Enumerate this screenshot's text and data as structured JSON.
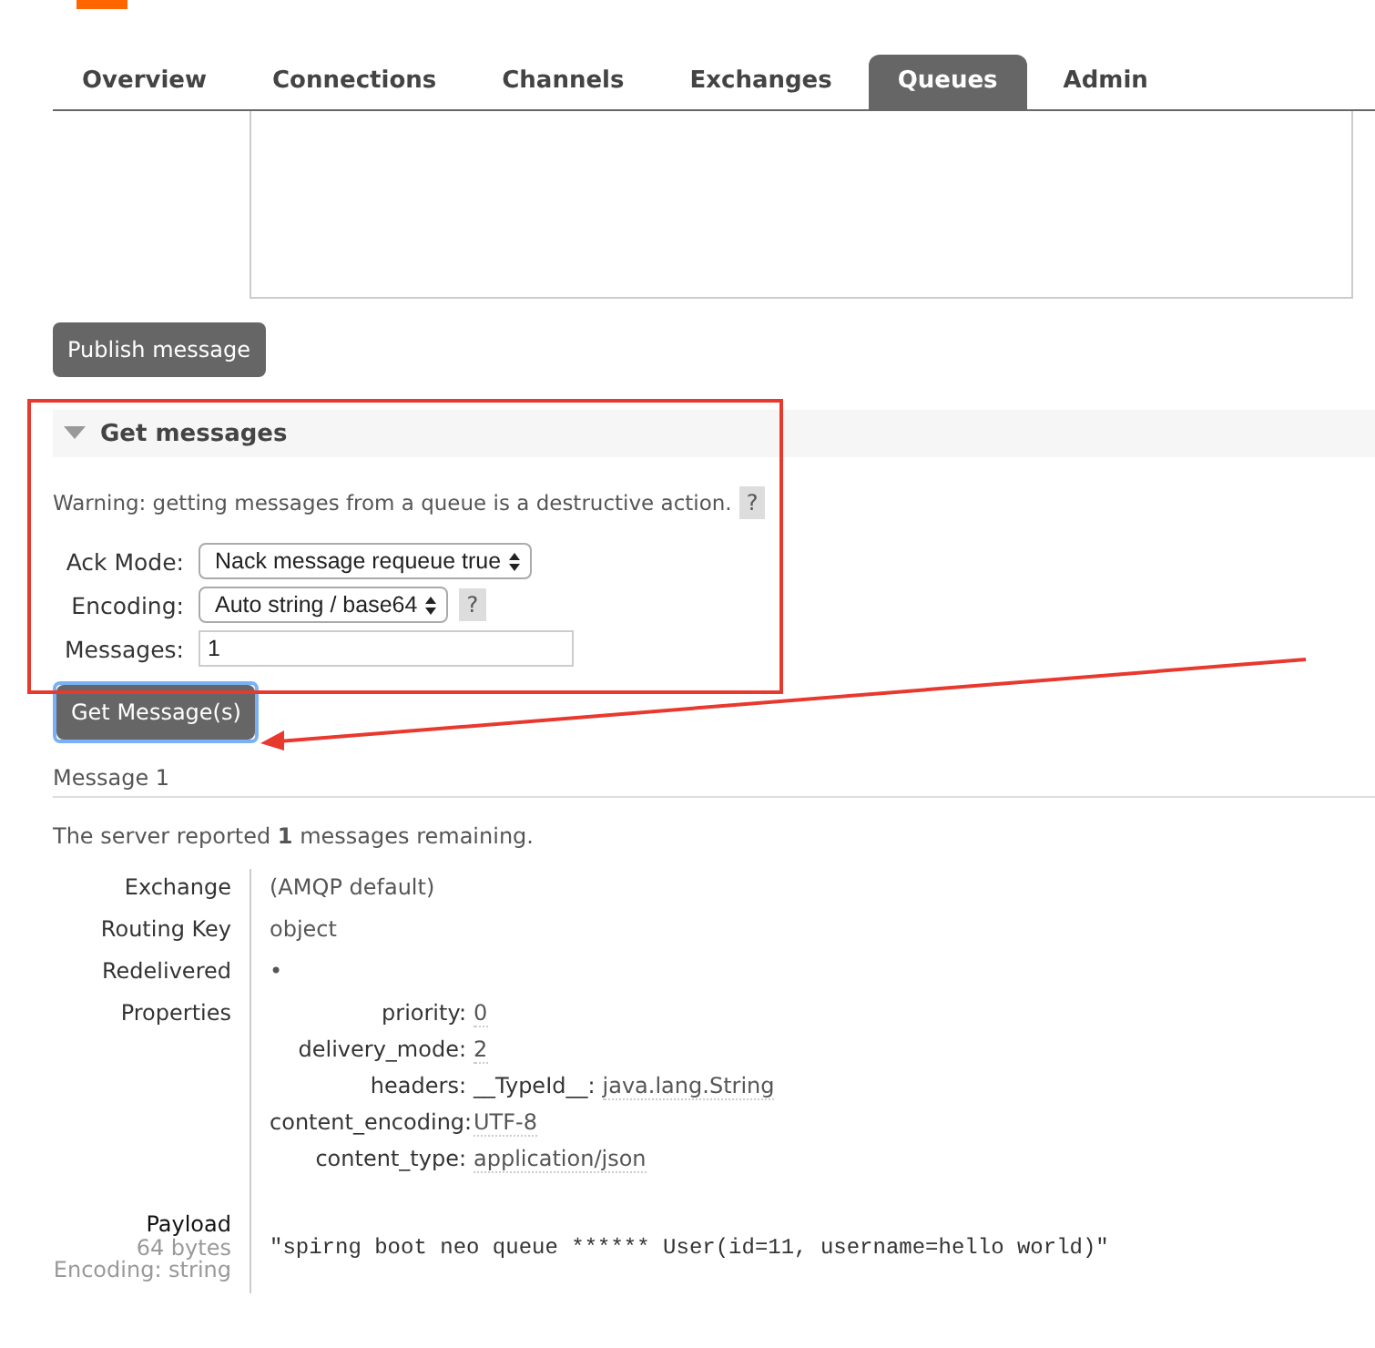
{
  "tabs": [
    {
      "label": "Overview",
      "selected": false
    },
    {
      "label": "Connections",
      "selected": false
    },
    {
      "label": "Channels",
      "selected": false
    },
    {
      "label": "Exchanges",
      "selected": false
    },
    {
      "label": "Queues",
      "selected": true
    },
    {
      "label": "Admin",
      "selected": false
    }
  ],
  "publish_button": "Publish message",
  "get_messages": {
    "title": "Get messages",
    "expanded": true,
    "warning": "Warning: getting messages from a queue is a destructive action.",
    "warning_help": "?",
    "fields": [
      {
        "kind": "select",
        "label": "Ack Mode:",
        "value": "Nack message requeue true"
      },
      {
        "kind": "select",
        "label": "Encoding:",
        "value": "Auto string / base64",
        "help": "?"
      },
      {
        "kind": "input",
        "label": "Messages:",
        "value": "1"
      }
    ],
    "button": "Get Message(s)"
  },
  "message": {
    "title": "Message 1",
    "summary": "The server reported **1** messages remaining.",
    "rows": [
      {
        "label": "Exchange",
        "value": "(AMQP default)"
      },
      {
        "label": "Routing Key",
        "value": "object"
      },
      {
        "label": "Redelivered",
        "value": "•"
      }
    ],
    "properties_label": "Properties",
    "properties": [
      {
        "key": "priority:",
        "value": "0"
      },
      {
        "key": "delivery_mode:",
        "value": "2"
      },
      {
        "key": "headers:",
        "subkey": "__TypeId__:",
        "value": "java.lang.String"
      },
      {
        "key": "content_encoding:",
        "value": "UTF-8"
      },
      {
        "key": "content_type:",
        "value": "application/json"
      }
    ],
    "payload": {
      "label": "Payload",
      "size": "64 bytes",
      "encoding": "Encoding: string",
      "value": "\"spirng boot neo queue ****** User(id=11, username=hello world)\""
    }
  }
}
